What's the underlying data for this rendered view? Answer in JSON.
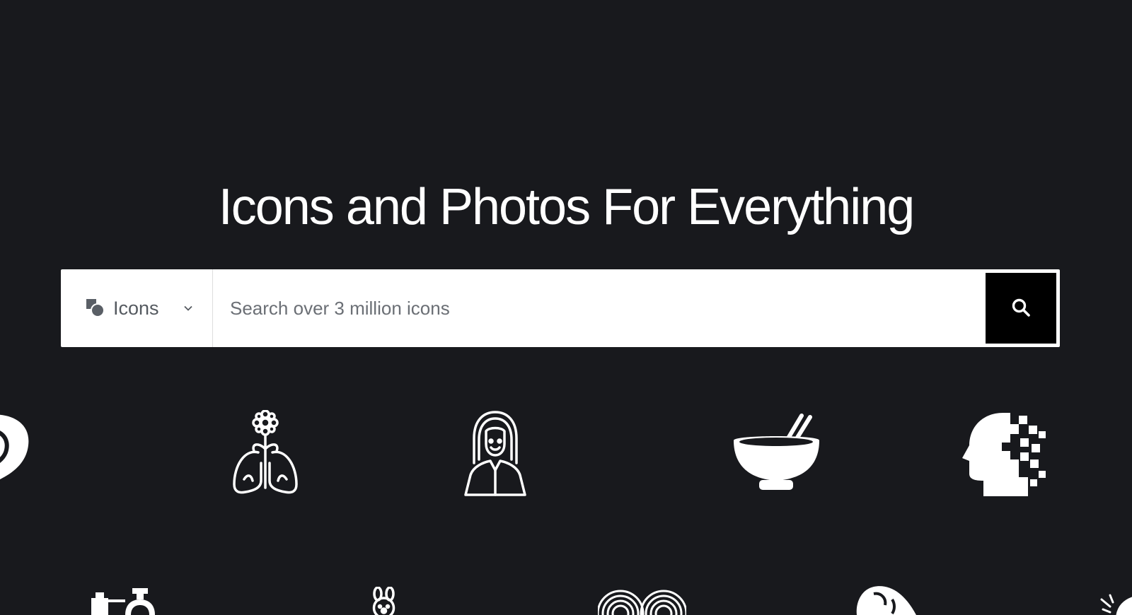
{
  "hero": {
    "title": "Icons and Photos For Everything"
  },
  "search": {
    "type_label": "Icons",
    "placeholder": "Search over 3 million icons",
    "type_icon": "shapes-icon",
    "chevron_icon": "chevron-down-icon",
    "button_icon": "search-icon"
  },
  "showcase_icons": [
    "partial-shape-icon",
    "lungs-flower-icon",
    "woman-portrait-icon",
    "bowl-chopsticks-icon",
    "pixelated-head-icon",
    "bottles-icon",
    "rabbit-icon",
    "concentric-heart-icon",
    "animal-head-icon",
    "sparkle-hand-icon"
  ],
  "colors": {
    "background": "#18191d",
    "search_bg": "#ffffff",
    "button_bg": "#000000",
    "text": "#ffffff"
  }
}
